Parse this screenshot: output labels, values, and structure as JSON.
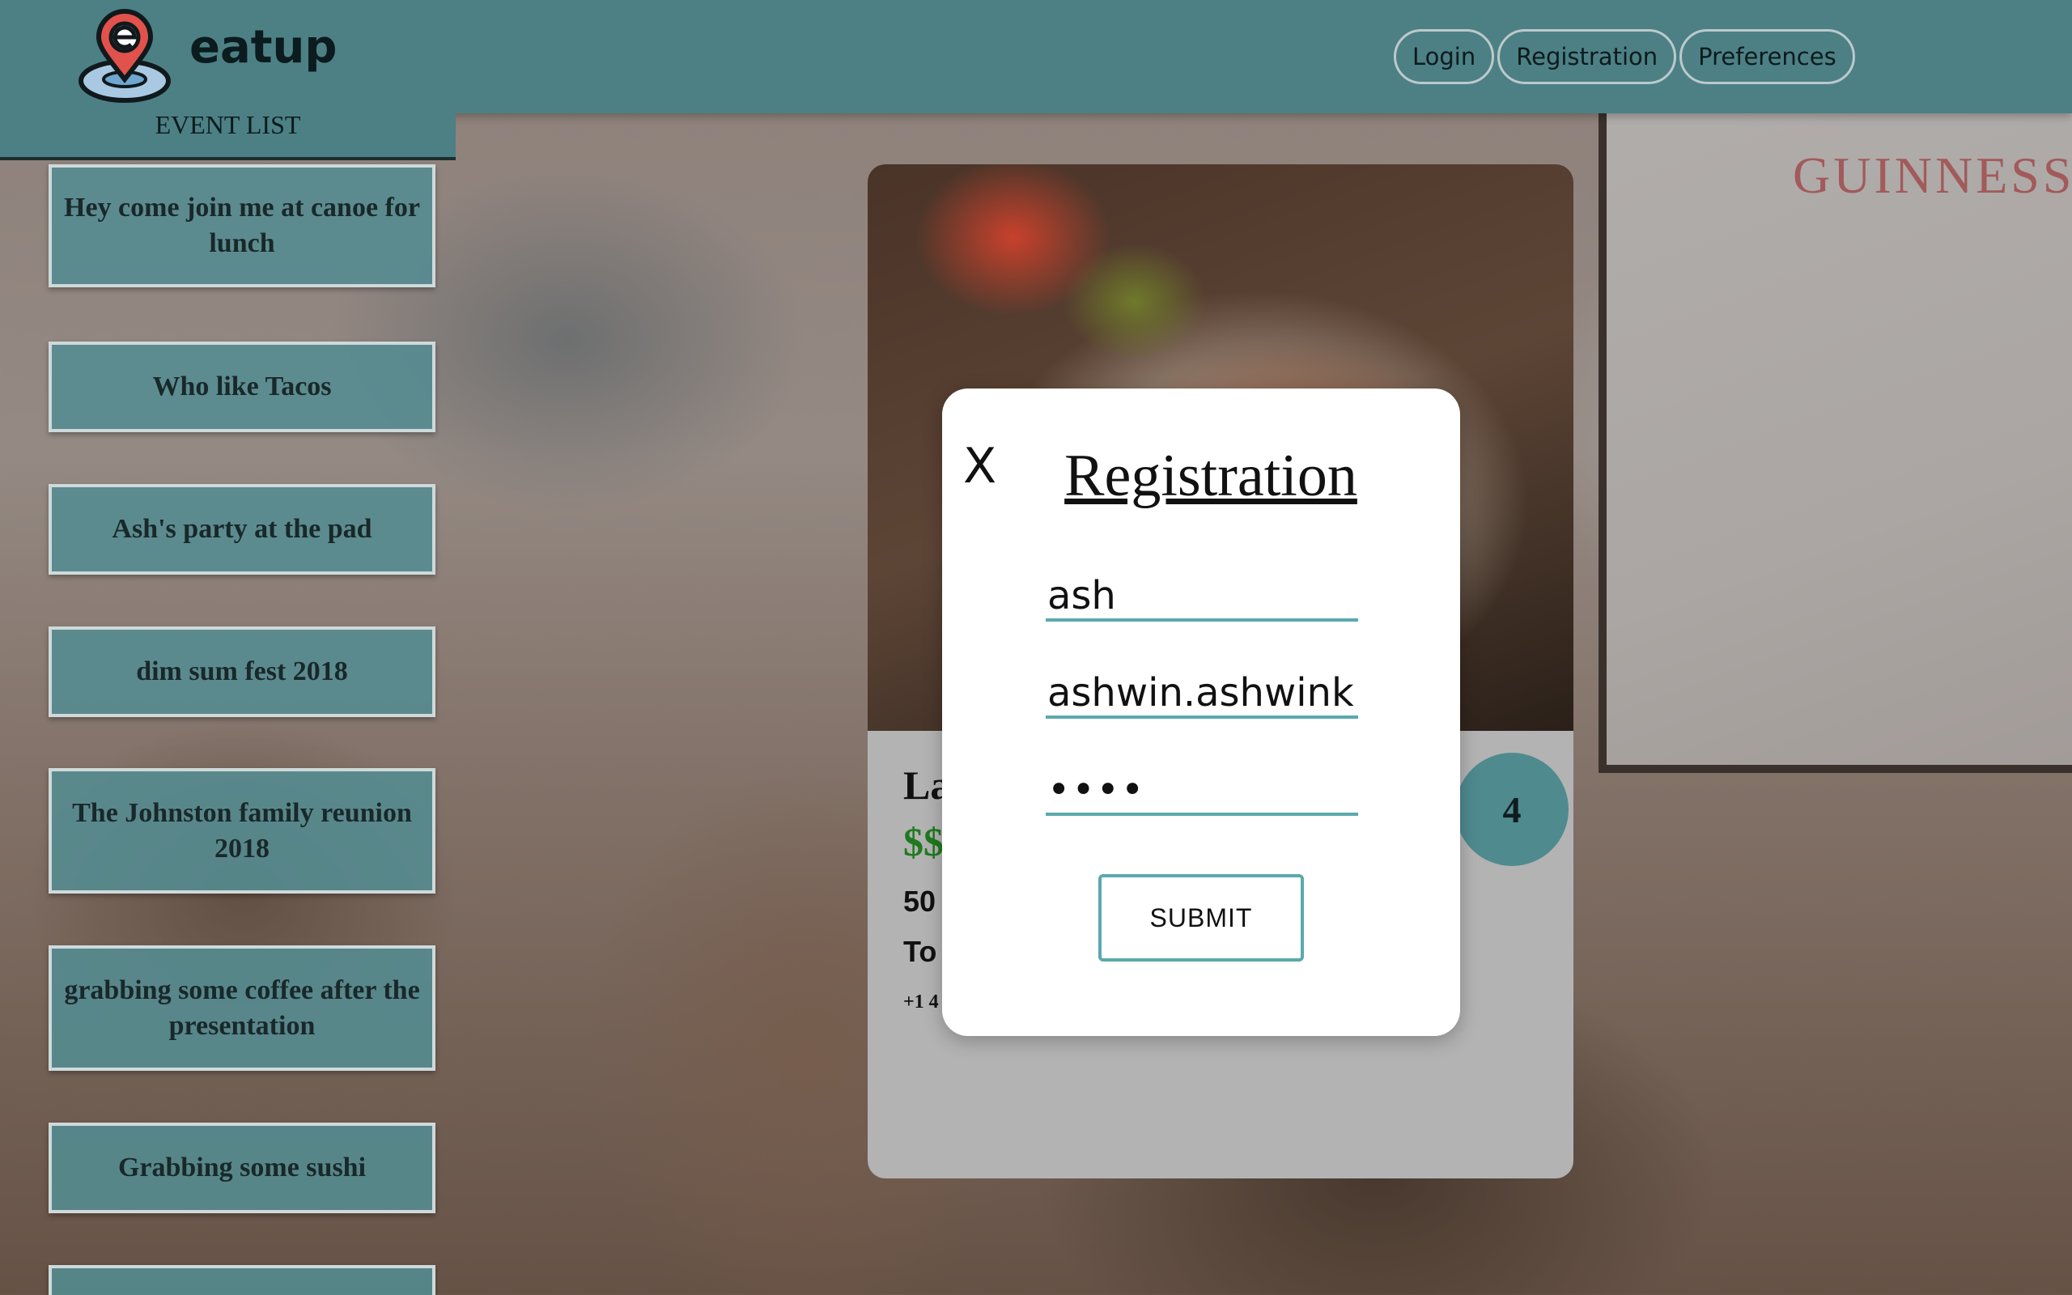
{
  "app": {
    "brand": "eatup"
  },
  "nav": {
    "login": "Login",
    "registration": "Registration",
    "preferences": "Preferences"
  },
  "background": {
    "poster_text": "GUINNESS"
  },
  "event_list": {
    "heading": "EVENT LIST",
    "items": [
      {
        "label": "Hey come join me at canoe for lunch"
      },
      {
        "label": "Who like Tacos"
      },
      {
        "label": "Ash's party at the pad"
      },
      {
        "label": "dim sum fest 2018"
      },
      {
        "label": "The Johnston family reunion 2018"
      },
      {
        "label": "grabbing some coffee after the presentation"
      },
      {
        "label": "Grabbing some sushi"
      },
      {
        "label": ""
      }
    ]
  },
  "restaurant_card": {
    "name_partial": "La",
    "price_partial": "$$",
    "address_line1_partial": "50",
    "address_line2_partial": "To",
    "phone_partial": "+1 4",
    "rating": "4"
  },
  "modal": {
    "title": "Registration",
    "close_label": "X",
    "fields": {
      "username": "ash",
      "email": "ashwin.ashwinkh",
      "password": "••••"
    },
    "submit_label": "SUBMIT"
  },
  "colors": {
    "header_teal": "#4c8085",
    "accent_teal": "#5aa9ad",
    "price_green": "#1f7a1f"
  }
}
